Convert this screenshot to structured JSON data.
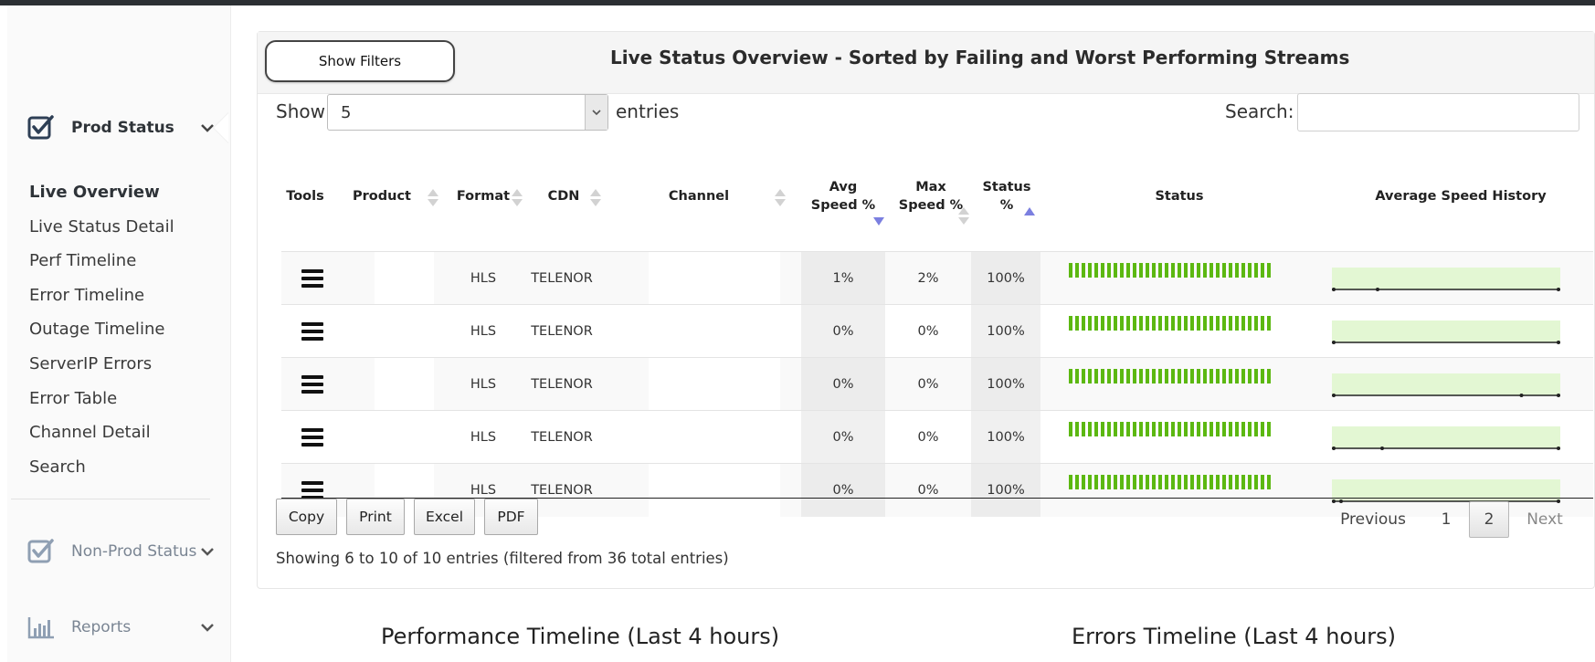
{
  "sidebar": {
    "prod_status": {
      "label": "Prod Status",
      "icon": "checkbox-checked-icon"
    },
    "items": [
      {
        "label": "Live Overview",
        "active": true
      },
      {
        "label": "Live Status Detail"
      },
      {
        "label": "Perf Timeline"
      },
      {
        "label": "Error Timeline"
      },
      {
        "label": "Outage Timeline"
      },
      {
        "label": "ServerIP Errors"
      },
      {
        "label": "Error Table"
      },
      {
        "label": "Channel Detail"
      },
      {
        "label": "Search"
      }
    ],
    "non_prod_status": {
      "label": "Non-Prod Status",
      "icon": "checkbox-checked-icon"
    },
    "reports": {
      "label": "Reports",
      "icon": "bar-chart-icon"
    }
  },
  "panel": {
    "show_filters": "Show Filters",
    "title": "Live Status Overview - Sorted by Failing and Worst Performing Streams",
    "length_prefix": "Show",
    "length_value": "5",
    "length_suffix": "entries",
    "search_label": "Search:",
    "search_value": ""
  },
  "table": {
    "columns": {
      "tools": "Tools",
      "product": "Product",
      "format": "Format",
      "cdn": "CDN",
      "channel": "Channel",
      "avg_speed_1": "Avg",
      "avg_speed_2": "Speed %",
      "max_speed_1": "Max",
      "max_speed_2": "Speed %",
      "status_pct_1": "Status",
      "status_pct_2": "%",
      "status": "Status",
      "history": "Average Speed History"
    },
    "rows": [
      {
        "format": "HLS",
        "cdn": "TELENOR",
        "avg": "1%",
        "max": "2%",
        "status_pct": "100%",
        "spikes": [
          0.2
        ]
      },
      {
        "format": "HLS",
        "cdn": "TELENOR",
        "avg": "0%",
        "max": "0%",
        "status_pct": "100%",
        "spikes": []
      },
      {
        "format": "HLS",
        "cdn": "TELENOR",
        "avg": "0%",
        "max": "0%",
        "status_pct": "100%",
        "spikes": [
          0.83
        ]
      },
      {
        "format": "HLS",
        "cdn": "TELENOR",
        "avg": "0%",
        "max": "0%",
        "status_pct": "100%",
        "spikes": [
          0.22
        ]
      },
      {
        "format": "HLS",
        "cdn": "TELENOR",
        "avg": "0%",
        "max": "0%",
        "status_pct": "100%",
        "spikes": [
          0.04
        ]
      }
    ],
    "status_color": "#5cb811",
    "history_fill": "#e3f7d3"
  },
  "buttons": {
    "copy": "Copy",
    "print": "Print",
    "excel": "Excel",
    "pdf": "PDF"
  },
  "pagination": {
    "previous": "Previous",
    "page1": "1",
    "page2": "2",
    "next": "Next"
  },
  "info": "Showing 6 to 10 of 10 entries (filtered from 36 total entries)",
  "bottom": {
    "perf_title": "Performance Timeline (Last 4 hours)",
    "errors_title": "Errors Timeline (Last 4 hours)"
  }
}
